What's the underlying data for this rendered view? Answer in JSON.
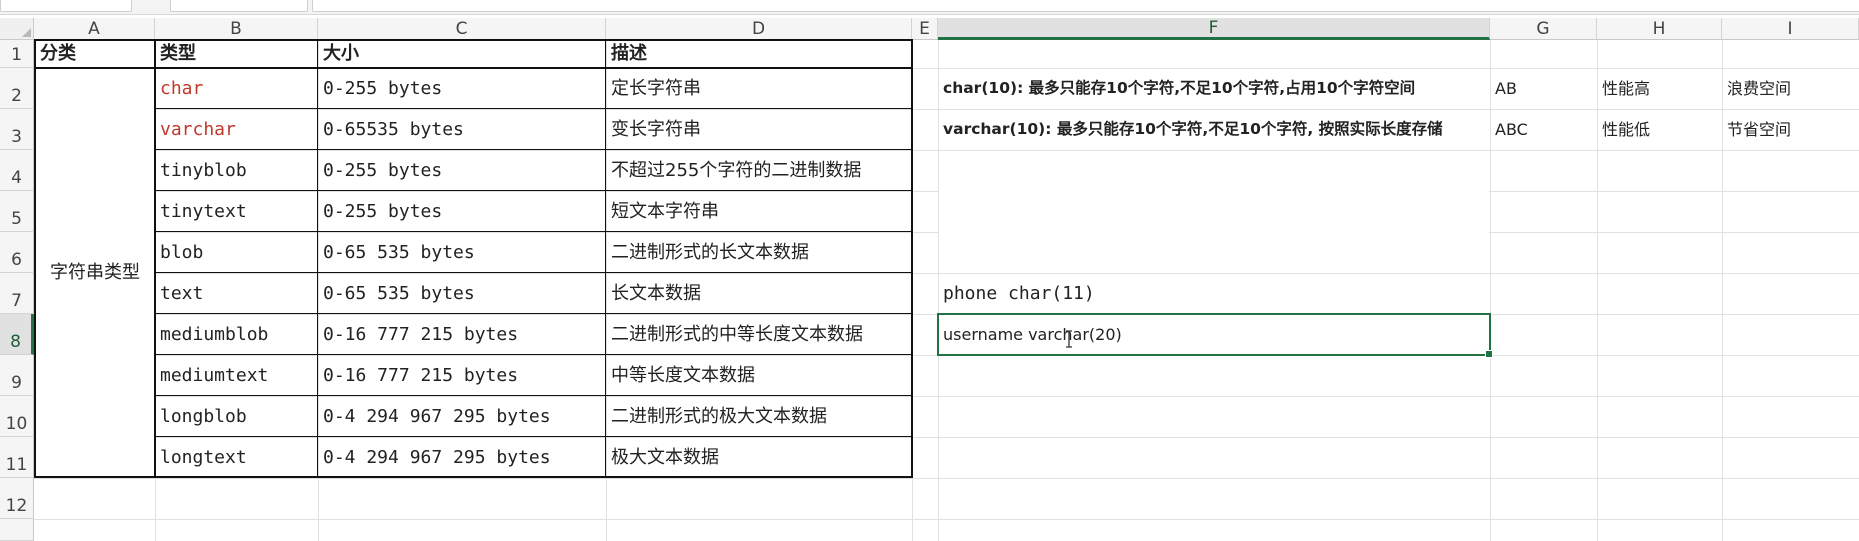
{
  "columns": [
    "A",
    "B",
    "C",
    "D",
    "E",
    "F",
    "G",
    "H",
    "I"
  ],
  "rows": [
    "1",
    "2",
    "3",
    "4",
    "5",
    "6",
    "7",
    "8",
    "9",
    "10",
    "11",
    "12"
  ],
  "table": {
    "headers": [
      "分类",
      "类型",
      "大小",
      "描述"
    ],
    "category": "字符串类型",
    "rows": [
      {
        "type": "char",
        "size": "0-255 bytes",
        "desc": "定长字符串"
      },
      {
        "type": "varchar",
        "size": "0-65535 bytes",
        "desc": "变长字符串"
      },
      {
        "type": "tinyblob",
        "size": "0-255 bytes",
        "desc": "不超过255个字符的二进制数据"
      },
      {
        "type": "tinytext",
        "size": "0-255 bytes",
        "desc": "短文本字符串"
      },
      {
        "type": "blob",
        "size": "0-65 535 bytes",
        "desc": "二进制形式的长文本数据"
      },
      {
        "type": "text",
        "size": "0-65 535 bytes",
        "desc": "长文本数据"
      },
      {
        "type": "mediumblob",
        "size": "0-16 777 215 bytes",
        "desc": "二进制形式的中等长度文本数据"
      },
      {
        "type": "mediumtext",
        "size": "0-16 777 215 bytes",
        "desc": "中等长度文本数据"
      },
      {
        "type": "longblob",
        "size": "0-4 294 967 295 bytes",
        "desc": "二进制形式的极大文本数据"
      },
      {
        "type": "longtext",
        "size": "0-4 294 967 295 bytes",
        "desc": "极大文本数据"
      }
    ]
  },
  "notes": {
    "char_note": "char(10): 最多只能存10个字符,不足10个字符,占用10个字符空间",
    "char_example": "AB",
    "char_perf": "性能高",
    "char_space": "浪费空间",
    "varchar_note": "varchar(10): 最多只能存10个字符,不足10个字符, 按照实际长度存储",
    "varchar_example": "ABC",
    "varchar_perf": "性能低",
    "varchar_space": "节省空间",
    "phone": "phone char(11)",
    "username": "username varchar(20)"
  },
  "colors": {
    "accent": "#217346",
    "red_text": "#c0392b"
  }
}
